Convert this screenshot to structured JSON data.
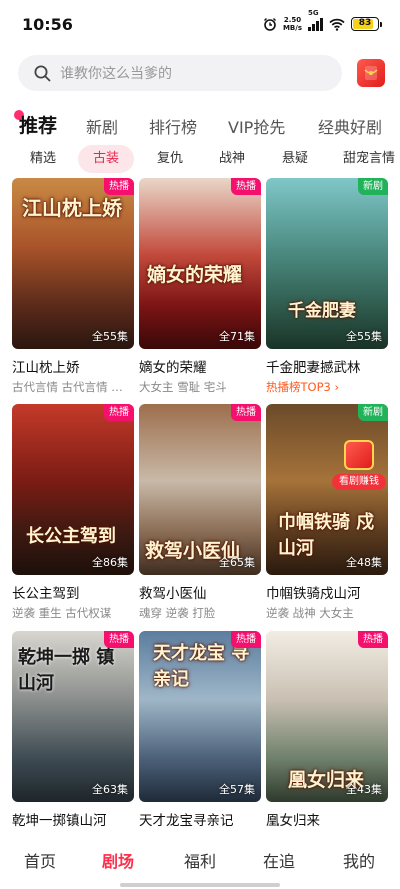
{
  "status_bar": {
    "time": "10:56",
    "net_speed": "2.50",
    "net_unit": "MB/s",
    "signal": "5G",
    "battery": "83"
  },
  "search": {
    "placeholder": "谁教你这么当爹的"
  },
  "top_tabs": [
    "推荐",
    "新剧",
    "排行榜",
    "VIP抢先",
    "经典好剧"
  ],
  "chips": [
    "精选",
    "古装",
    "复仇",
    "战神",
    "悬疑",
    "甜宠言情"
  ],
  "active_chip": "古装",
  "cards": [
    {
      "title": "江山枕上娇",
      "tags": "古代言情 古代言情 …",
      "badge": "热播",
      "episodes": "全55集",
      "poster_text": "江山枕上娇"
    },
    {
      "title": "嫡女的荣耀",
      "tags": "大女主 雪耻 宅斗",
      "badge": "热播",
      "episodes": "全71集",
      "poster_text": "嫡女的荣耀"
    },
    {
      "title": "千金肥妻撼武林",
      "tags": "热播榜TOP3 ›",
      "badge": "新剧",
      "episodes": "全55集",
      "poster_text": "千金肥妻"
    },
    {
      "title": "长公主驾到",
      "tags": "逆袭 重生 古代权谋",
      "badge": "热播",
      "episodes": "全86集",
      "poster_text": "长公主驾到"
    },
    {
      "title": "救驾小医仙",
      "tags": "魂穿 逆袭 打脸",
      "badge": "热播",
      "episodes": "全65集",
      "poster_text": "救驾小医仙"
    },
    {
      "title": "巾帼铁骑戍山河",
      "tags": "逆袭 战神 大女主",
      "badge": "新剧",
      "episodes": "全48集",
      "poster_text": "巾帼铁骑 戍山河"
    },
    {
      "title": "乾坤一掷镇山河",
      "tags": "",
      "badge": "热播",
      "episodes": "全63集",
      "poster_text": "乾坤一掷 镇山河"
    },
    {
      "title": "天才龙宝寻亲记",
      "tags": "",
      "badge": "热播",
      "episodes": "全57集",
      "poster_text": "天才龙宝 寻亲记"
    },
    {
      "title": "凰女归来",
      "tags": "",
      "badge": "热播",
      "episodes": "全43集",
      "poster_text": "凰女归来"
    }
  ],
  "watch_earn": "看剧赚钱",
  "bottom_nav": [
    "首页",
    "剧场",
    "福利",
    "在追",
    "我的"
  ],
  "active_nav": "剧场",
  "colors": {
    "accent": "#ff2e4d",
    "hot_badge": "#f5106e",
    "new_badge": "#21b25a",
    "rank_text": "#ff5a1f"
  }
}
